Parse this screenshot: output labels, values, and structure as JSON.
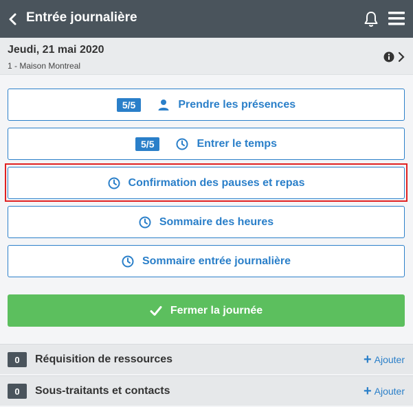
{
  "header": {
    "title": "Entrée journalière"
  },
  "datebar": {
    "date": "Jeudi, 21 mai 2020",
    "site": "1 - Maison Montreal"
  },
  "actions": [
    {
      "badge": "5/5",
      "label": "Prendre les présences",
      "icon": "person-icon"
    },
    {
      "badge": "5/5",
      "label": "Entrer le temps",
      "icon": "clock-icon"
    },
    {
      "label": "Confirmation des pauses et repas",
      "icon": "clock-icon"
    },
    {
      "label": "Sommaire des heures",
      "icon": "clock-icon"
    },
    {
      "label": "Sommaire entrée journalière",
      "icon": "clock-icon"
    }
  ],
  "close_day": {
    "label": "Fermer la journée",
    "icon": "check-icon"
  },
  "sections": [
    {
      "count": "0",
      "label": "Réquisition de ressources",
      "add_label": "Ajouter"
    },
    {
      "count": "0",
      "label": "Sous-traitants et contacts",
      "add_label": "Ajouter"
    }
  ],
  "colors": {
    "header_bg": "#4a545c",
    "accent": "#2a7fc9",
    "success": "#5cbf5e",
    "highlight": "#e02020"
  }
}
